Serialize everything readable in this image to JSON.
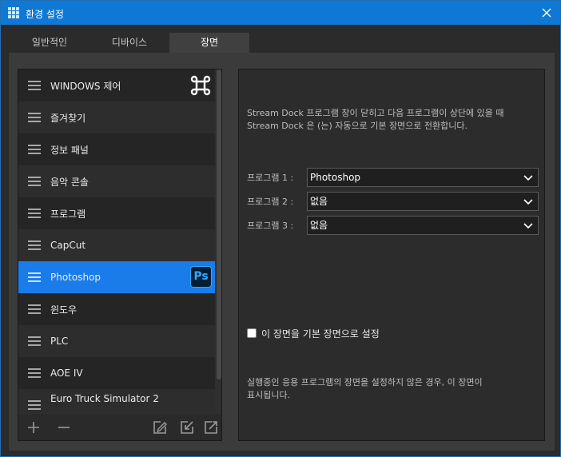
{
  "window": {
    "title": "환경 설정"
  },
  "tabs": [
    {
      "label": "일반적인"
    },
    {
      "label": "디바이스"
    },
    {
      "label": "장면"
    }
  ],
  "scene_list": {
    "items": [
      {
        "label": "WINDOWS 제어",
        "icon": "command-key-icon"
      },
      {
        "label": "즐겨찾기"
      },
      {
        "label": "정보 패널"
      },
      {
        "label": "음악 콘솔"
      },
      {
        "label": "프로그램"
      },
      {
        "label": "CapCut"
      },
      {
        "label": "Photoshop",
        "icon": "photoshop-icon",
        "icon_text": "Ps",
        "selected": true
      },
      {
        "label": "윈도우"
      },
      {
        "label": "PLC"
      },
      {
        "label": "AOE IV"
      },
      {
        "label": "Euro Truck Simulator 2"
      }
    ],
    "toolbar": {
      "add": "add-icon",
      "remove": "remove-icon",
      "edit": "edit-icon",
      "import": "import-icon",
      "export": "export-icon"
    }
  },
  "settings": {
    "description_line1": "Stream Dock  프로그램 창이 닫히고 다음 프로그램이 상단에 있을 때",
    "description_line2": "Stream Dock 은 (는) 자동으로 기본 장면으로 전환합니다.",
    "programs": [
      {
        "label": "프로그램 1 :",
        "value": "Photoshop"
      },
      {
        "label": "프로그램 2 :",
        "value": "없음"
      },
      {
        "label": "프로그램 3 :",
        "value": "없음"
      }
    ],
    "default_scene_checkbox": {
      "label": "이 장면을 기본 장면으로 설정",
      "checked": false
    },
    "footnote_line1": "실행중인 응용 프로그램의 장면을 설정하지 않은 경우,    이 장면이",
    "footnote_line2": "표시됩니다."
  },
  "colors": {
    "titlebar": "#0f78d4",
    "selected_item": "#1a7ce8",
    "background": "#2b2b2b"
  }
}
